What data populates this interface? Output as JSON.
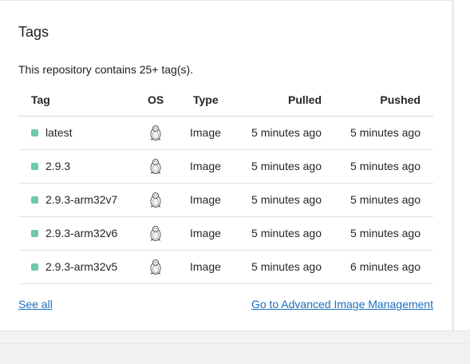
{
  "section": {
    "title": "Tags",
    "summary": "This repository contains 25+ tag(s)."
  },
  "table": {
    "headers": {
      "tag": "Tag",
      "os": "OS",
      "type": "Type",
      "pulled": "Pulled",
      "pushed": "Pushed"
    },
    "rows": [
      {
        "tag": "latest",
        "os_icon": "linux-penguin-icon",
        "type": "Image",
        "pulled": "5 minutes ago",
        "pushed": "5 minutes ago"
      },
      {
        "tag": "2.9.3",
        "os_icon": "linux-penguin-icon",
        "type": "Image",
        "pulled": "5 minutes ago",
        "pushed": "5 minutes ago"
      },
      {
        "tag": "2.9.3-arm32v7",
        "os_icon": "linux-penguin-icon",
        "type": "Image",
        "pulled": "5 minutes ago",
        "pushed": "5 minutes ago"
      },
      {
        "tag": "2.9.3-arm32v6",
        "os_icon": "linux-penguin-icon",
        "type": "Image",
        "pulled": "5 minutes ago",
        "pushed": "5 minutes ago"
      },
      {
        "tag": "2.9.3-arm32v5",
        "os_icon": "linux-penguin-icon",
        "type": "Image",
        "pulled": "5 minutes ago",
        "pushed": "6 minutes ago"
      }
    ]
  },
  "links": {
    "see_all": "See all",
    "advanced": "Go to Advanced Image Management"
  },
  "colors": {
    "status_dot": "#6ec9a6",
    "link": "#1d6fc0"
  }
}
